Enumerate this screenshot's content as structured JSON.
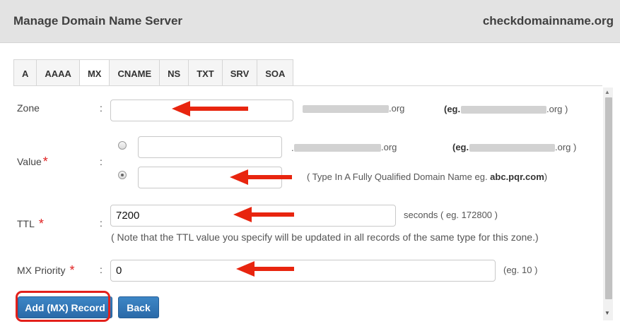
{
  "header": {
    "title": "Manage Domain Name Server",
    "site": "checkdomainname.org"
  },
  "tabs": [
    {
      "label": "A",
      "active": false
    },
    {
      "label": "AAAA",
      "active": false
    },
    {
      "label": "MX",
      "active": true
    },
    {
      "label": "CNAME",
      "active": false
    },
    {
      "label": "NS",
      "active": false
    },
    {
      "label": "TXT",
      "active": false
    },
    {
      "label": "SRV",
      "active": false
    },
    {
      "label": "SOA",
      "active": false
    }
  ],
  "form": {
    "zone": {
      "label": "Zone",
      "colon": ":",
      "value": "",
      "suffix": ".org",
      "example_prefix": "(eg.",
      "example_suffix": ".org )"
    },
    "value": {
      "label": "Value",
      "required": "*",
      "colon": ":",
      "option1": {
        "value": "",
        "suffix": ".org",
        "example_prefix": "(eg.",
        "example_suffix": ".org )",
        "checked": false
      },
      "option2": {
        "value": "",
        "hint_prefix": "( Type In A Fully Qualified Domain Name eg. ",
        "hint_example": "abc.pqr.com",
        "hint_suffix": ")",
        "checked": true
      }
    },
    "ttl": {
      "label": "TTL",
      "required": "*",
      "colon": ":",
      "value": "7200",
      "hint": "seconds ( eg. 172800 )",
      "note": "( Note that the TTL value you specify will be updated in all records of the same type for this zone.)"
    },
    "mx_priority": {
      "label": "MX Priority",
      "required": "*",
      "colon": ":",
      "value": "0",
      "hint": "(eg. 10 )"
    }
  },
  "buttons": {
    "add": "Add (MX) Record",
    "back": "Back"
  },
  "colors": {
    "header_bg": "#e3e3e3",
    "button": "#2f74b5",
    "required": "#e02020",
    "annotation": "#e3201b"
  }
}
